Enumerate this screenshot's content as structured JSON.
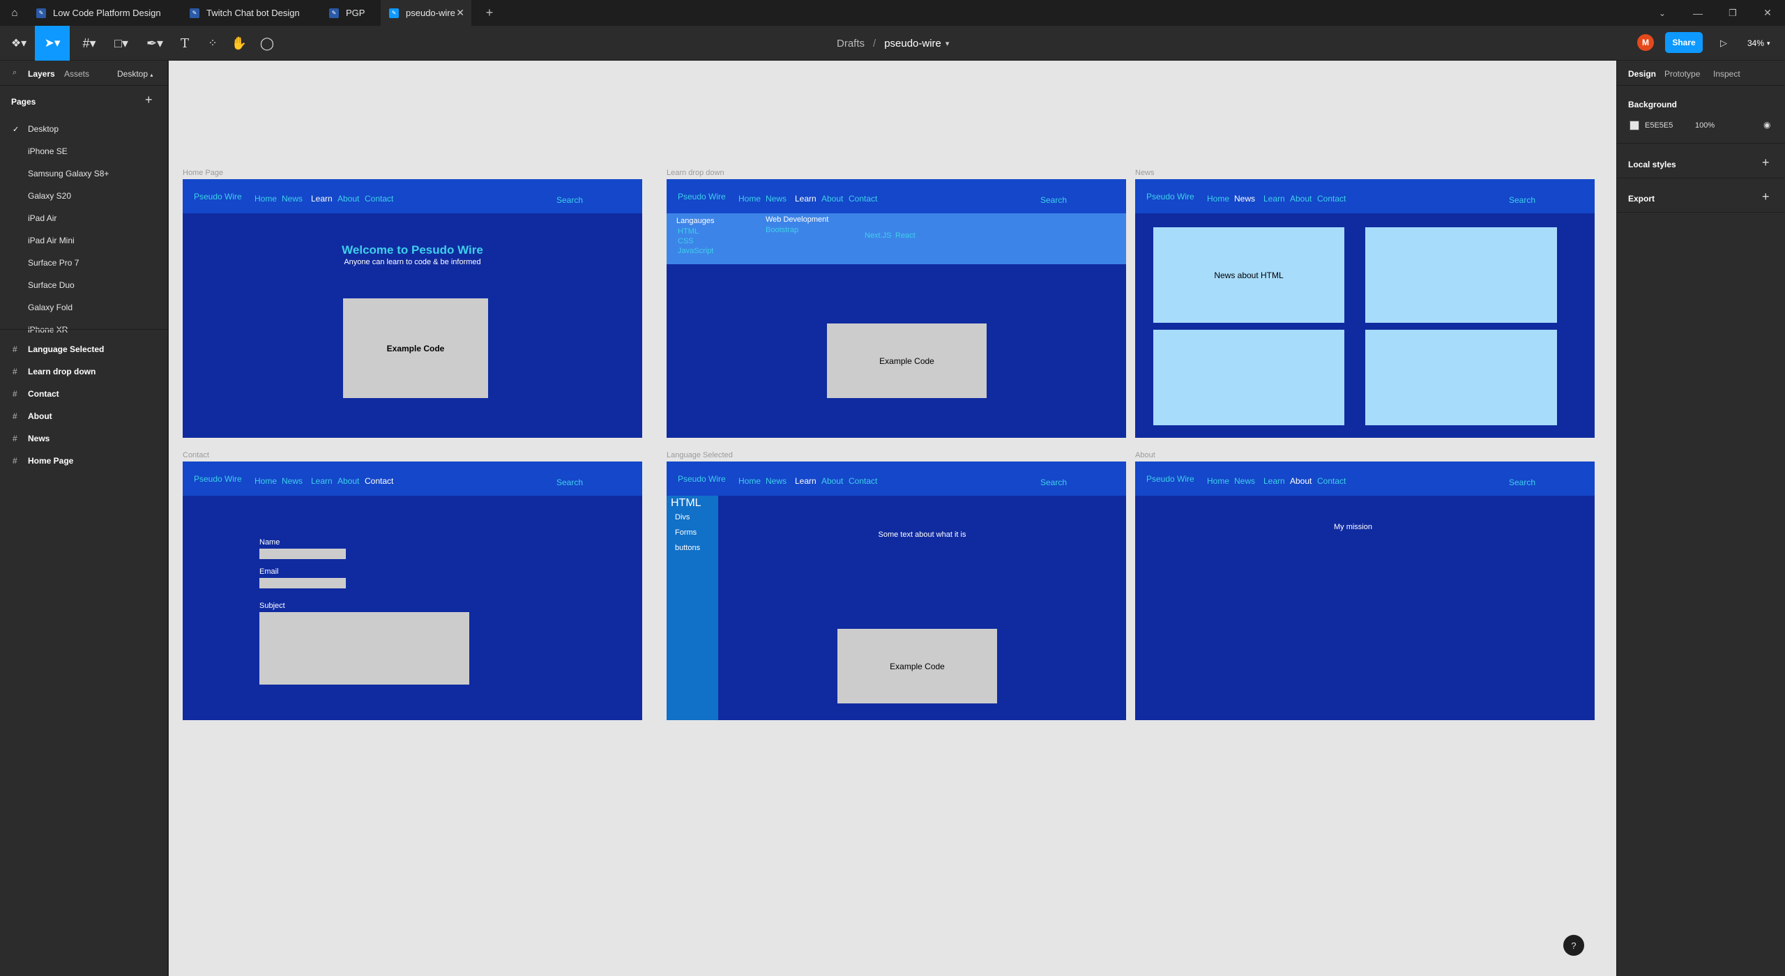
{
  "tabs": [
    {
      "label": "Low Code Platform Design"
    },
    {
      "label": "Twitch Chat bot Design"
    },
    {
      "label": "PGP"
    },
    {
      "label": "pseudo-wire"
    }
  ],
  "toolbar": {
    "breadcrumb_root": "Drafts",
    "breadcrumb_sep": "/",
    "file_name": "pseudo-wire",
    "avatar_letter": "M",
    "share_label": "Share",
    "zoom": "34%"
  },
  "left": {
    "tab_layers": "Layers",
    "tab_assets": "Assets",
    "page_selector": "Desktop",
    "pages_header": "Pages",
    "pages": [
      "Desktop",
      "iPhone SE",
      "Samsung Galaxy S8+",
      "Galaxy S20",
      "iPad Air",
      "iPad Air Mini",
      "Surface Pro 7",
      "Surface Duo",
      "Galaxy Fold",
      "iPhone XR"
    ],
    "frames": [
      "Language Selected",
      "Learn drop down",
      "Contact",
      "About",
      "News",
      "Home Page"
    ]
  },
  "right": {
    "tab_design": "Design",
    "tab_prototype": "Prototype",
    "tab_inspect": "Inspect",
    "background_title": "Background",
    "bg_hex": "E5E5E5",
    "bg_opacity": "100%",
    "local_styles": "Local styles",
    "export": "Export"
  },
  "frames": {
    "nav": {
      "brand": "Pseudo Wire",
      "home": "Home",
      "news": "News",
      "learn": "Learn",
      "about": "About",
      "contact": "Contact",
      "search": "Search"
    },
    "home": {
      "label": "Home Page",
      "title": "Welcome to Pesudo Wire",
      "subtitle": "Anyone can learn to code & be informed",
      "code": "Example Code"
    },
    "learn": {
      "label": "Learn drop down",
      "languages_heading": "Langauges",
      "languages": [
        "HTML",
        "CSS",
        "JavaScript"
      ],
      "webdev_heading": "Web Development",
      "webdev": [
        "Bootstrap"
      ],
      "frameworks": [
        "Next.JS",
        "React"
      ],
      "code": "Example Code"
    },
    "news": {
      "label": "News",
      "card1": "News about HTML"
    },
    "contact": {
      "label": "Contact",
      "name": "Name",
      "email": "Email",
      "subject": "Subject"
    },
    "lang": {
      "label": "Language Selected",
      "heading": "HTML",
      "items": [
        "Divs",
        "Forms",
        "buttons"
      ],
      "text": "Some text about what it is",
      "code": "Example Code"
    },
    "about": {
      "label": "About",
      "mission": "My mission"
    }
  },
  "colors": {
    "frame_bg": "#102ba0",
    "nav_bg": "#1447c9",
    "link": "#3ed0ea",
    "share": "#0d99ff",
    "avatar": "#e4491c"
  }
}
